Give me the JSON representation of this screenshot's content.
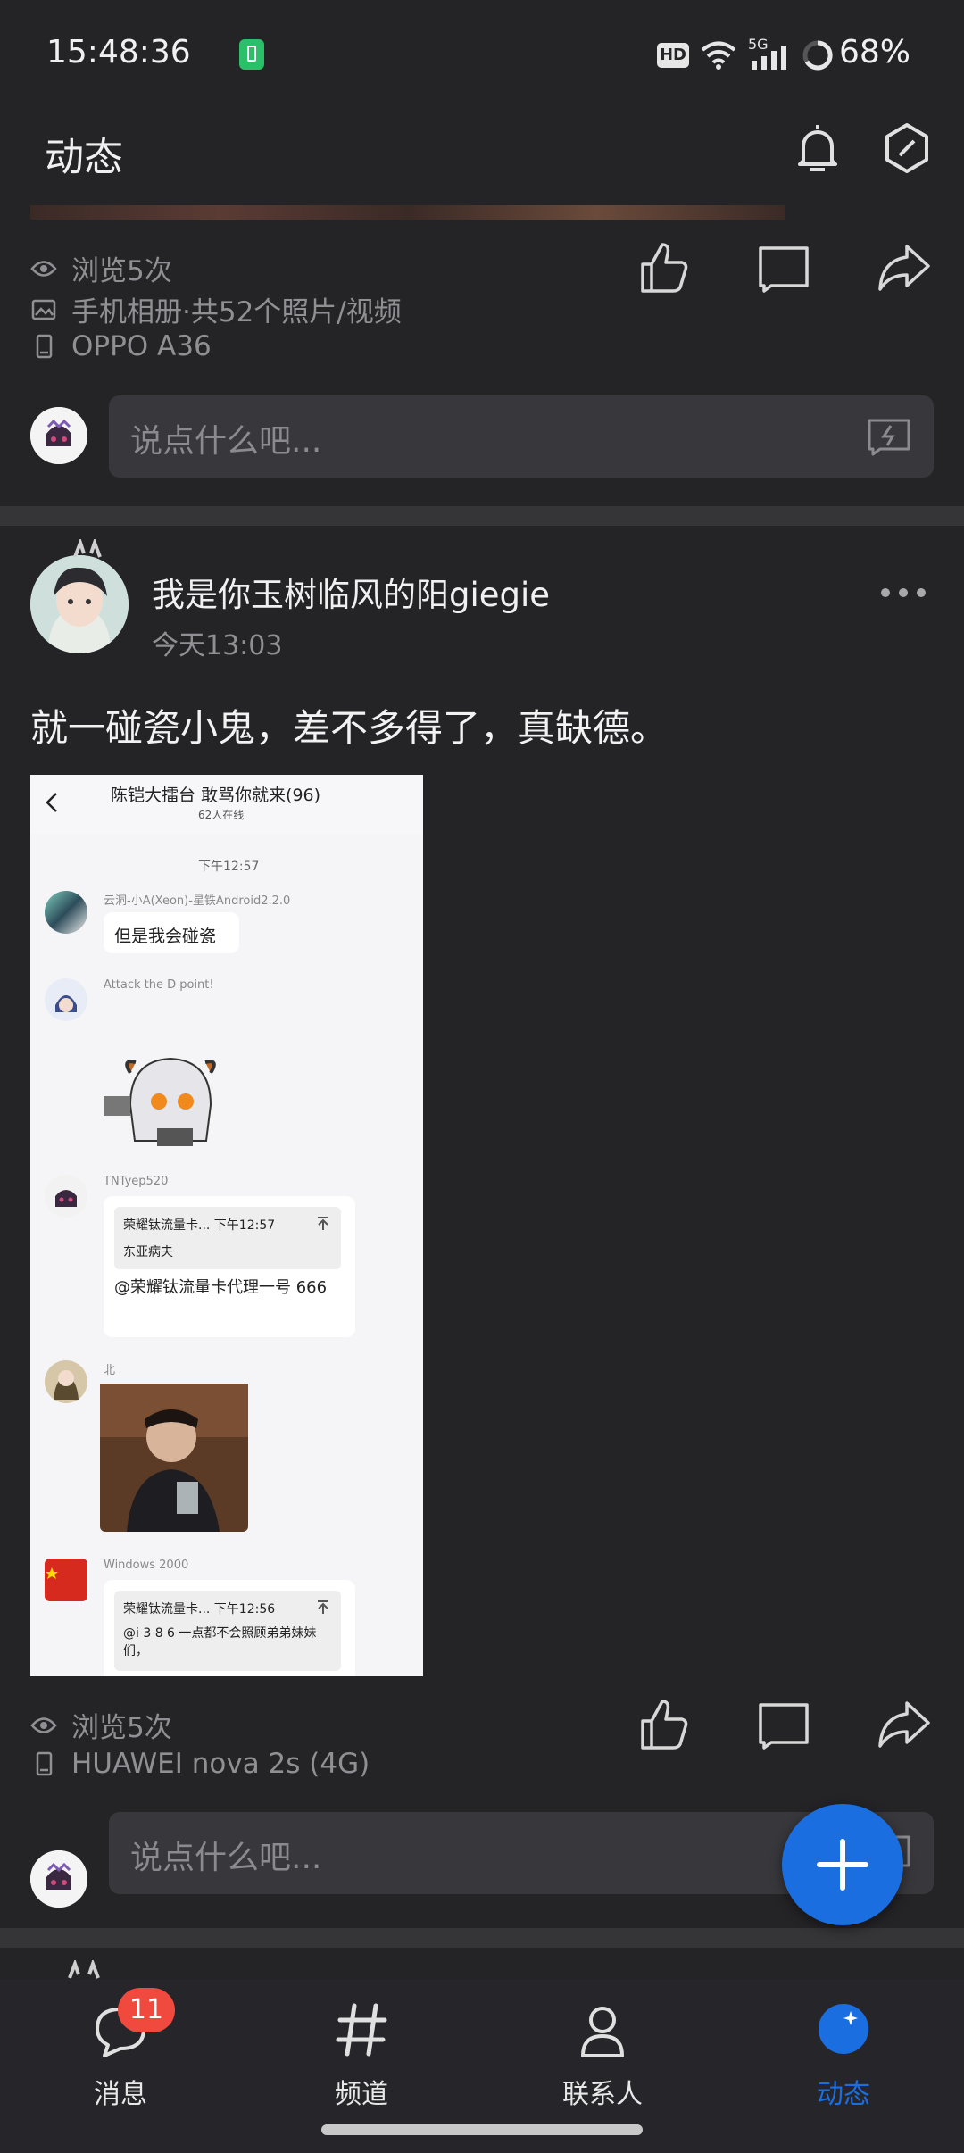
{
  "status_bar": {
    "time": "15:48:36",
    "network": "5G",
    "hd_badge": "HD",
    "battery": "68%"
  },
  "header": {
    "title": "动态"
  },
  "post_prev": {
    "views": "浏览5次",
    "album": "手机相册·共52个照片/视频",
    "device": "OPPO A36",
    "comment_placeholder": "说点什么吧..."
  },
  "post": {
    "author": "我是你玉树临风的阳giegie",
    "time": "今天13:03",
    "content": "就一碰瓷小鬼，差不多得了，真缺德。",
    "views": "浏览5次",
    "device": "HUAWEI nova 2s (4G)",
    "comment_placeholder": "说点什么吧...",
    "screenshot": {
      "group_title": "陈铠大擂台 敢骂你就来(96)",
      "online": "62人在线",
      "time_divider": "下午12:57",
      "messages": [
        {
          "sender": "云洞-小A(Xeon)-星铁Android2.2.0",
          "text": "但是我会碰瓷"
        },
        {
          "sender": "Attack the D point!",
          "text": ""
        },
        {
          "sender": "TNTyep520",
          "quote_title": "荣耀钛流量卡... 下午12:57",
          "quote_text": "东亚病夫",
          "text": "@荣耀钛流量卡代理一号 666"
        },
        {
          "sender": "北",
          "text": ""
        },
        {
          "sender": "Windows 2000",
          "quote_title": "荣耀钛流量卡... 下午12:56",
          "quote_text": "@i 3 8 6 一点都不会照顾弟弟妹妹们，"
        }
      ]
    }
  },
  "bottom_nav": {
    "items": [
      {
        "label": "消息",
        "badge": "11"
      },
      {
        "label": "频道"
      },
      {
        "label": "联系人"
      },
      {
        "label": "动态"
      }
    ]
  },
  "colors": {
    "accent": "#1a6ee0",
    "badge": "#f04a3e",
    "background": "#242427"
  },
  "icons": [
    "bell-icon",
    "settings-hexagon-icon",
    "eye-icon",
    "album-icon",
    "phone-icon",
    "like-icon",
    "comment-icon",
    "share-icon",
    "emoji-icon",
    "more-icon",
    "add-icon",
    "message-icon",
    "hash-icon",
    "contact-icon",
    "feed-icon"
  ]
}
